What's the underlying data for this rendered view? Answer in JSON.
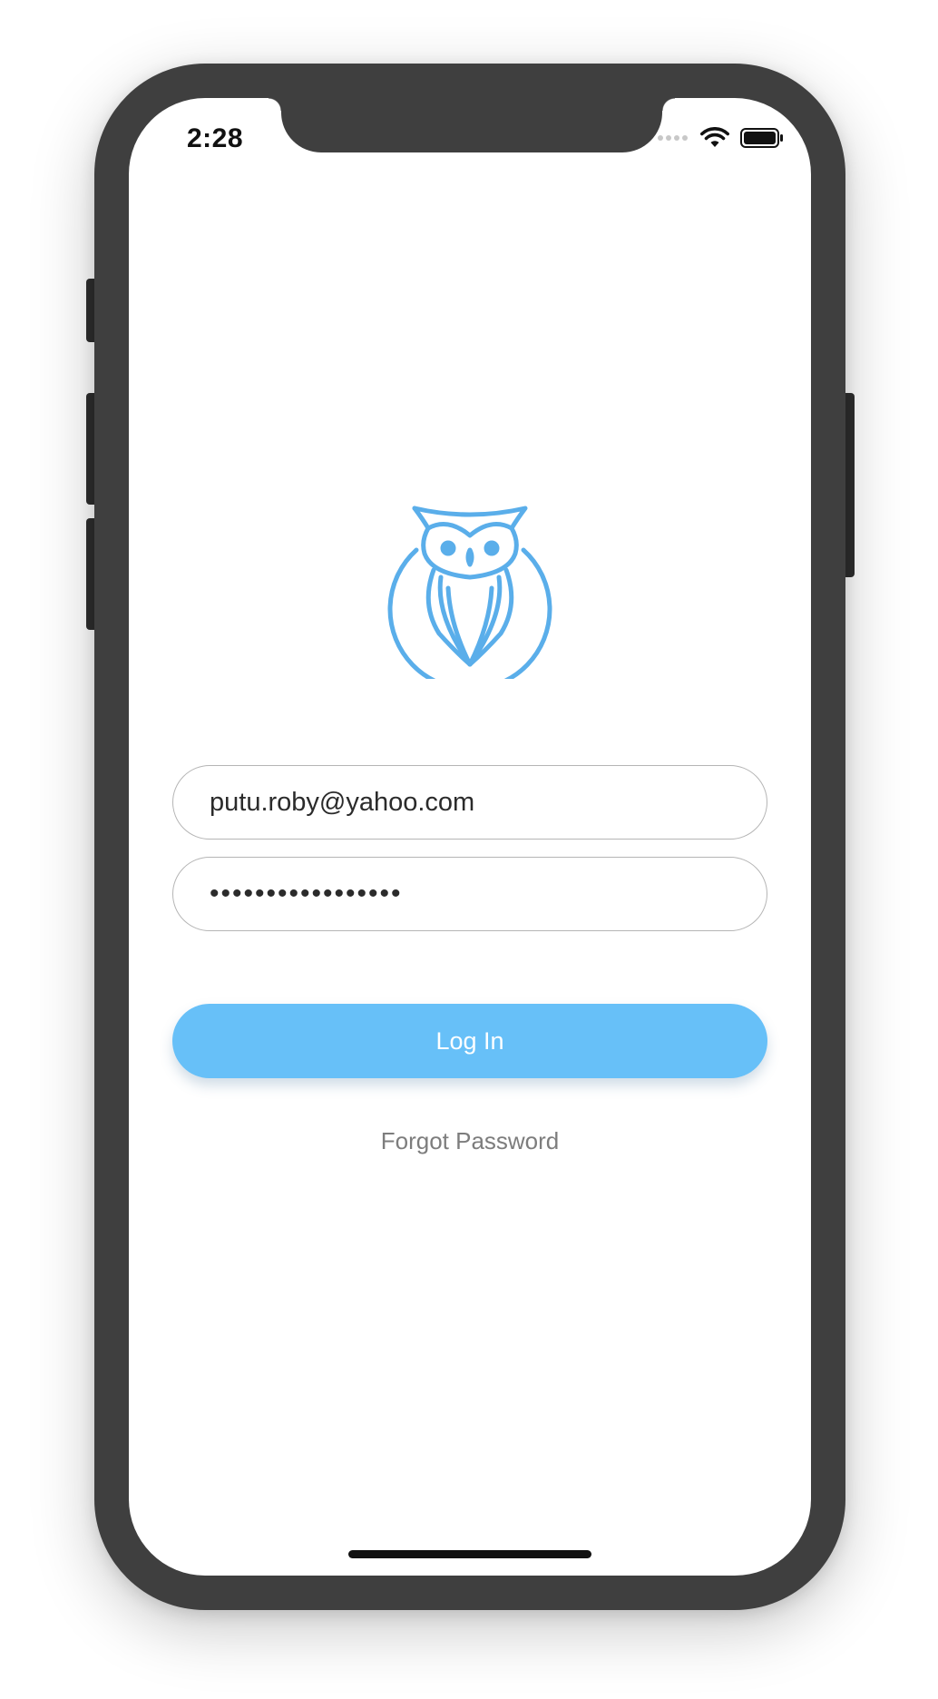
{
  "status_bar": {
    "time": "2:28",
    "icons": [
      "signal-dots-icon",
      "wifi-icon",
      "battery-icon"
    ]
  },
  "logo": {
    "icon": "owl-logo-icon",
    "color": "#5aaeea"
  },
  "login_form": {
    "email_value": "putu.roby@yahoo.com",
    "password_value": "•••••••••••••••••",
    "login_label": "Log In",
    "forgot_label": "Forgot Password"
  },
  "colors": {
    "accent": "#67c0f8",
    "logo": "#5aaeea",
    "frame": "#3f3f3f",
    "muted_text": "#7d7d7d"
  }
}
